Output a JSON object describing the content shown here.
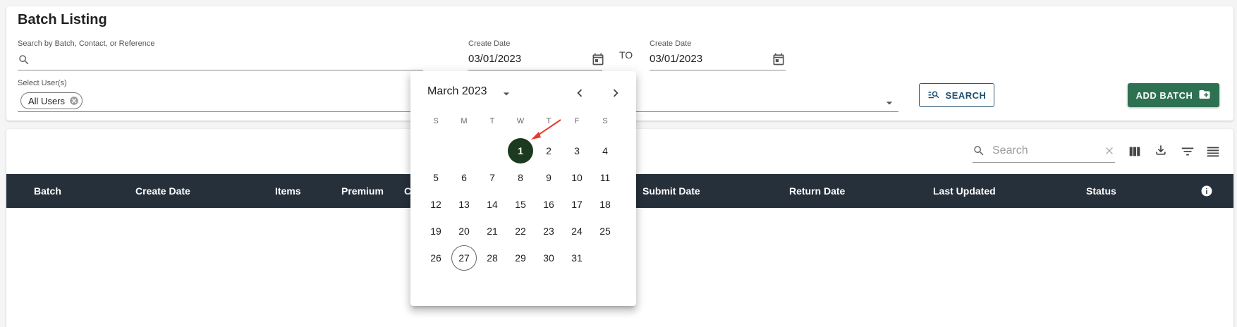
{
  "page": {
    "title": "Batch Listing"
  },
  "filters": {
    "search_label": "Search by Batch, Contact, or Reference",
    "create_date_from_label": "Create Date",
    "create_date_from_value": "03/01/2023",
    "to_label": "TO",
    "create_date_to_label": "Create Date",
    "create_date_to_value": "03/01/2023",
    "users_label": "Select User(s)",
    "users_chip": "All Users",
    "search_button": "SEARCH",
    "add_batch_button": "ADD BATCH"
  },
  "toolbar": {
    "search_placeholder": "Search"
  },
  "table": {
    "columns": [
      "Batch",
      "Create Date",
      "Items",
      "Premium",
      "C",
      "Submit Date",
      "Return Date",
      "Last Updated",
      "Status"
    ]
  },
  "datepicker": {
    "month_label": "March 2023",
    "weekdays": [
      "S",
      "M",
      "T",
      "W",
      "T",
      "F",
      "S"
    ],
    "days": [
      "1",
      "2",
      "3",
      "4",
      "5",
      "6",
      "7",
      "8",
      "9",
      "10",
      "11",
      "12",
      "13",
      "14",
      "15",
      "16",
      "17",
      "18",
      "19",
      "20",
      "21",
      "22",
      "23",
      "24",
      "25",
      "26",
      "27",
      "28",
      "29",
      "30",
      "31"
    ],
    "selected_day": "1",
    "today_day": "27"
  },
  "colors": {
    "header_bg": "#26303b",
    "primary_green": "#2e7152",
    "selected_day_bg": "#1b3a1f",
    "search_button_text": "#1f4e6e",
    "annotation_arrow": "#e53a2f"
  },
  "icons": {
    "search_field": "search-icon",
    "date_from": "calendar-icon",
    "date_to": "calendar-icon",
    "users_dropdown": "arrow-drop-down-icon",
    "search_button": "manage-search-icon",
    "add_batch": "create-new-folder-icon",
    "toolbar": [
      "view-column-icon",
      "download-icon",
      "filter-icon",
      "density-icon"
    ],
    "table_info": "info-icon"
  }
}
